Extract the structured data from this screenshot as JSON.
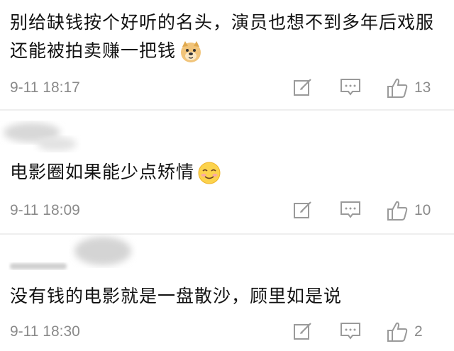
{
  "comments": [
    {
      "text": "别给缺钱按个好听的名头，演员也想不到多年后戏服还能被拍卖赚一把钱",
      "emoji": "doge-emoji",
      "time": "9-11 18:17",
      "likes": "13"
    },
    {
      "text": "电影圈如果能少点矫情",
      "emoji": "smile-emoji",
      "time": "9-11 18:09",
      "likes": "10"
    },
    {
      "text": "没有钱的电影就是一盘散沙，顾里如是说",
      "time": "9-11 18:30",
      "likes": "2"
    }
  ],
  "colors": {
    "text": "#111111",
    "meta": "#8a8a8a",
    "divider": "#eeeeee"
  },
  "icons": [
    "edit-icon",
    "comment-icon",
    "thumbs-up-icon"
  ]
}
